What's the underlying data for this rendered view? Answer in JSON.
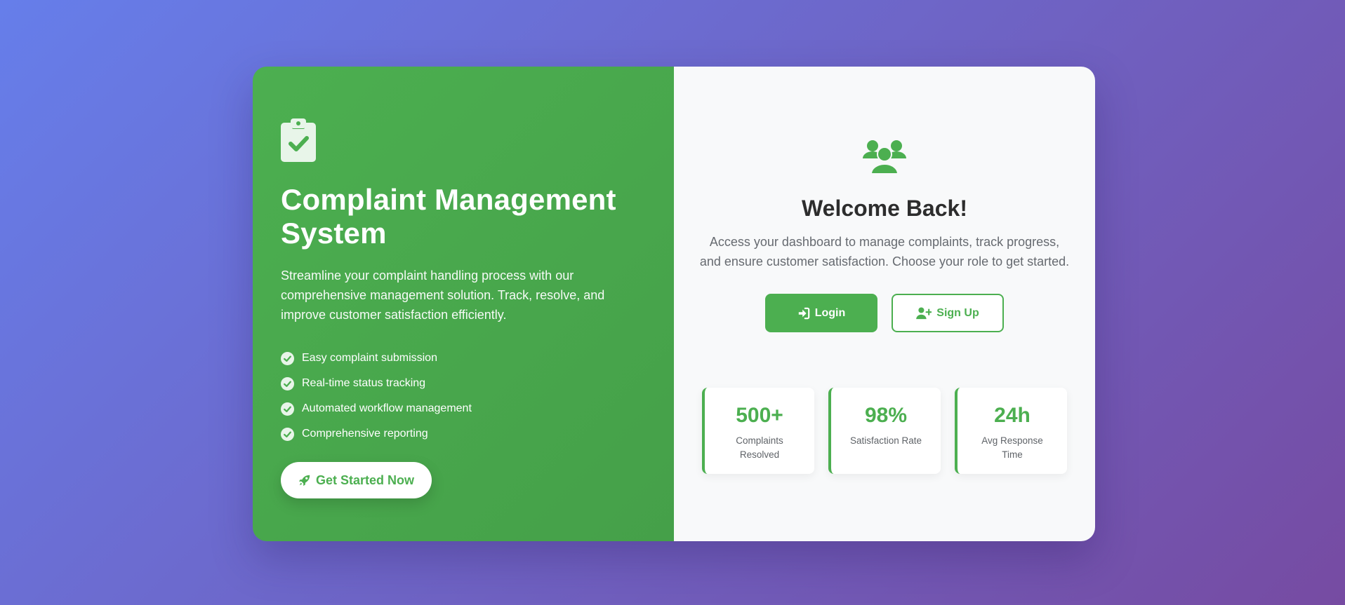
{
  "left": {
    "title": "Complaint Management System",
    "description": "Streamline your complaint handling process with our comprehensive management solution. Track, resolve, and improve customer satisfaction efficiently.",
    "features": [
      "Easy complaint submission",
      "Real-time status tracking",
      "Automated workflow management",
      "Comprehensive reporting"
    ],
    "cta_label": "Get Started Now"
  },
  "right": {
    "heading": "Welcome Back!",
    "subtext": "Access your dashboard to manage complaints, track progress, and ensure customer satisfaction. Choose your role to get started.",
    "login_label": "Login",
    "signup_label": "Sign Up",
    "stats": [
      {
        "value": "500+",
        "label": "Complaints Resolved"
      },
      {
        "value": "98%",
        "label": "Satisfaction Rate"
      },
      {
        "value": "24h",
        "label": "Avg Response Time"
      }
    ]
  },
  "icons": {
    "logo": "clipboard-check-icon",
    "feature": "check-circle-icon",
    "cta": "rocket-icon",
    "welcome": "users-icon",
    "login": "sign-in-icon",
    "signup": "user-plus-icon"
  },
  "colors": {
    "accent": "#4caf50",
    "background_start": "#667eea",
    "background_end": "#764ba2",
    "panel_right": "#f8f9fa",
    "heading_text": "#2d2d2d",
    "muted_text": "#666a70"
  }
}
